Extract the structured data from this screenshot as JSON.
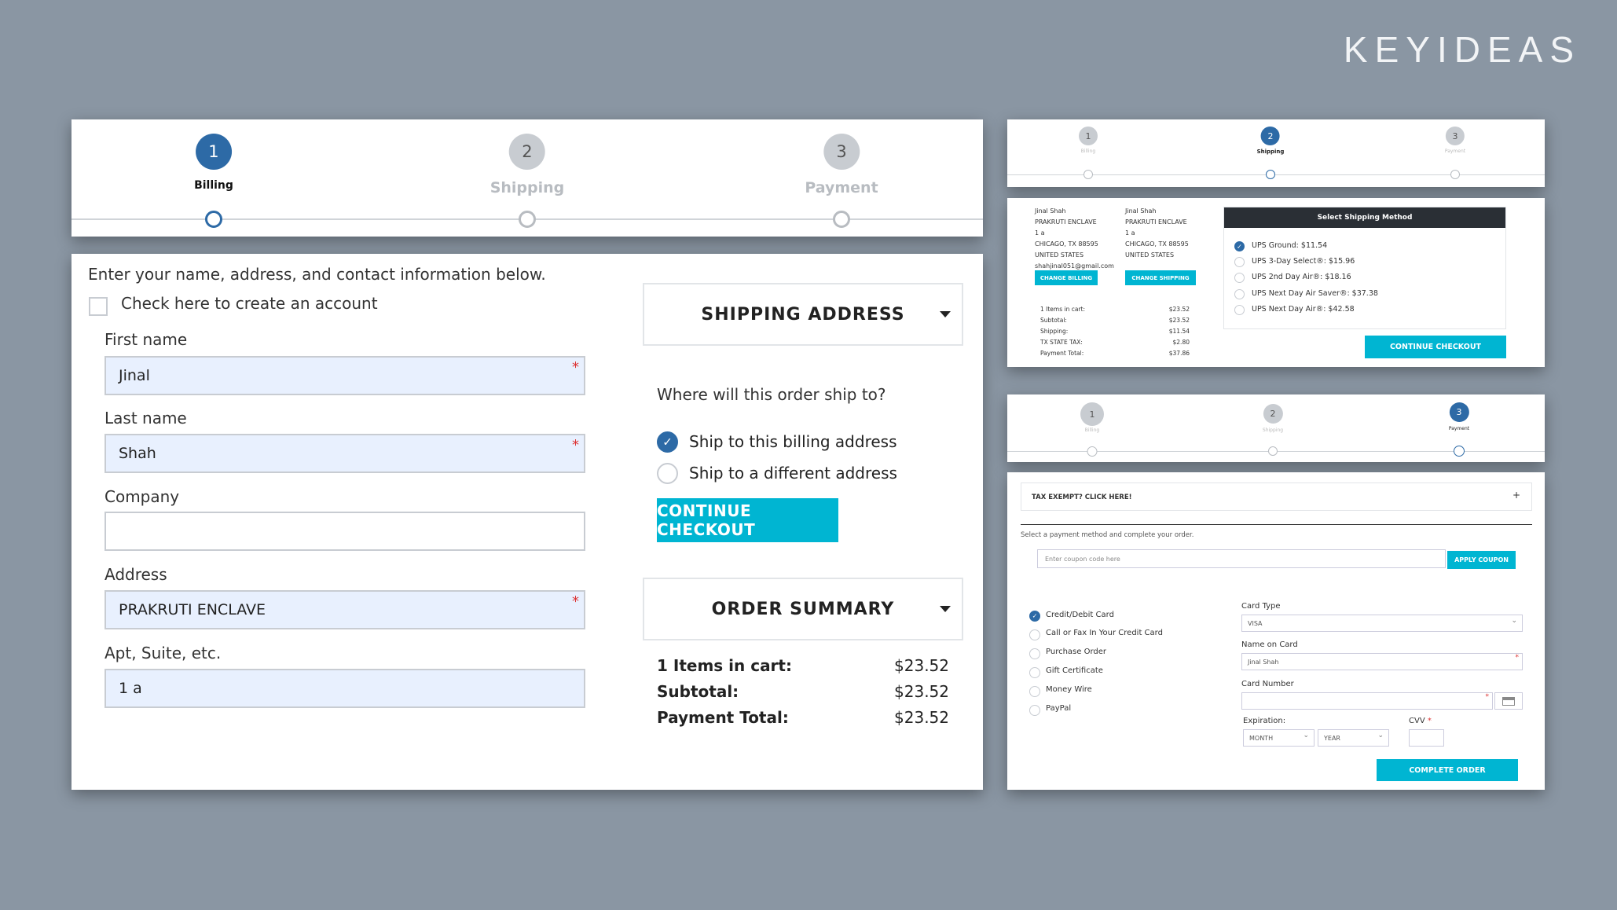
{
  "brand": {
    "logo": "KEYIDEAS"
  },
  "colors": {
    "accent": "#00b5d2",
    "step_active": "#2d6aa6",
    "step_inactive": "#c8ccd1",
    "autofill": "#e8f0fe"
  },
  "main": {
    "steps": [
      {
        "num": "1",
        "label": "Billing"
      },
      {
        "num": "2",
        "label": "Shipping"
      },
      {
        "num": "3",
        "label": "Payment"
      }
    ],
    "intro": "Enter your name, address, and contact information below.",
    "create_account": "Check here to create an account",
    "fields": [
      {
        "label": "First name",
        "value": "Jinal",
        "required": "*"
      },
      {
        "label": "Last name",
        "value": "Shah",
        "required": "*"
      },
      {
        "label": "Company",
        "value": "",
        "required": ""
      },
      {
        "label": "Address",
        "value": "PRAKRUTI ENCLAVE",
        "required": "*"
      },
      {
        "label": "Apt, Suite, etc.",
        "value": "1 a",
        "required": ""
      }
    ],
    "shipping_title": "SHIPPING ADDRESS",
    "ship_question": "Where will this order ship to?",
    "ship_options": [
      "Ship to this billing address",
      "Ship to a different address"
    ],
    "continue": "CONTINUE CHECKOUT",
    "summary_title": "ORDER SUMMARY",
    "summary": [
      {
        "label": "1 Items in cart:",
        "value": "$23.52"
      },
      {
        "label": "Subtotal:",
        "value": "$23.52"
      },
      {
        "label": "Payment Total:",
        "value": "$23.52"
      }
    ]
  },
  "shipping_step": {
    "steps": [
      {
        "num": "1",
        "label": "Billing"
      },
      {
        "num": "2",
        "label": "Shipping"
      },
      {
        "num": "3",
        "label": "Payment"
      }
    ],
    "billing_addr": [
      "Jinal Shah",
      "PRAKRUTI ENCLAVE",
      "1 a",
      "CHICAGO, TX 88595",
      "UNITED STATES",
      "shahjinal051@gmail.com"
    ],
    "shipping_addr": [
      "Jinal Shah",
      "PRAKRUTI ENCLAVE",
      "1 a",
      "CHICAGO, TX 88595",
      "UNITED STATES"
    ],
    "change_billing": "CHANGE BILLING",
    "change_shipping": "CHANGE SHIPPING",
    "totals": [
      {
        "label": "1 Items in cart:",
        "value": "$23.52"
      },
      {
        "label": "Subtotal:",
        "value": "$23.52"
      },
      {
        "label": "Shipping:",
        "value": "$11.54"
      },
      {
        "label": "TX STATE TAX:",
        "value": "$2.80"
      },
      {
        "label": "Payment Total:",
        "value": "$37.86"
      }
    ],
    "method_title": "Select Shipping Method",
    "methods": [
      "UPS Ground: $11.54",
      "UPS 3-Day Select®: $15.96",
      "UPS 2nd Day Air®: $18.16",
      "UPS Next Day Air Saver®: $37.38",
      "UPS Next Day Air®: $42.58"
    ],
    "continue": "CONTINUE CHECKOUT"
  },
  "payment_step": {
    "steps": [
      {
        "num": "1",
        "label": "Billing"
      },
      {
        "num": "2",
        "label": "Shipping"
      },
      {
        "num": "3",
        "label": "Payment"
      }
    ],
    "tax_exempt": "TAX EXEMPT? CLICK HERE!",
    "tax_plus": "+",
    "instruction": "Select a payment method and complete your order.",
    "coupon_placeholder": "Enter coupon code here",
    "apply": "APPLY COUPON",
    "methods": [
      "Credit/Debit Card",
      "Call or Fax In Your Credit Card",
      "Purchase Order",
      "Gift Certificate",
      "Money Wire",
      "PayPal"
    ],
    "card_type_label": "Card Type",
    "card_type": "VISA",
    "name_label": "Name on Card",
    "name_value": "Jinal Shah",
    "number_label": "Card Number",
    "exp_label": "Expiration:",
    "month": "MONTH",
    "year": "YEAR",
    "cvv_label": "CVV",
    "cvv_req": "*",
    "complete": "COMPLETE ORDER"
  }
}
